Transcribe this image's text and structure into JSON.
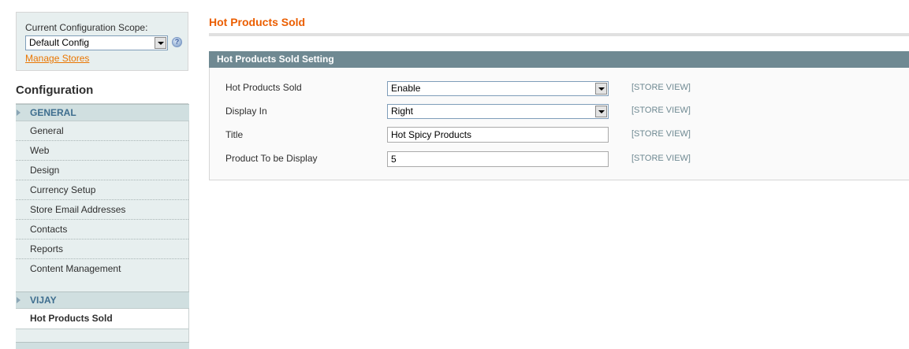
{
  "scope": {
    "label": "Current Configuration Scope:",
    "selected": "Default Config",
    "manage_link": "Manage Stores",
    "help_glyph": "?"
  },
  "sidebar": {
    "title": "Configuration",
    "groups": [
      {
        "label": "GENERAL",
        "items": [
          {
            "label": "General"
          },
          {
            "label": "Web"
          },
          {
            "label": "Design"
          },
          {
            "label": "Currency Setup"
          },
          {
            "label": "Store Email Addresses"
          },
          {
            "label": "Contacts"
          },
          {
            "label": "Reports"
          },
          {
            "label": "Content Management"
          }
        ]
      },
      {
        "label": "VIJAY",
        "items": [
          {
            "label": "Hot Products Sold",
            "active": true
          }
        ]
      }
    ]
  },
  "main": {
    "title": "Hot Products Sold",
    "fieldset": {
      "title": "Hot Products Sold Setting",
      "rows": [
        {
          "label": "Hot Products Sold",
          "type": "select",
          "value": "Enable",
          "scope": "[STORE VIEW]"
        },
        {
          "label": "Display In",
          "type": "select",
          "value": "Right",
          "scope": "[STORE VIEW]"
        },
        {
          "label": "Title",
          "type": "text",
          "value": "Hot Spicy Products",
          "scope": "[STORE VIEW]"
        },
        {
          "label": "Product To be Display",
          "type": "text",
          "value": "5",
          "scope": "[STORE VIEW]"
        }
      ]
    }
  },
  "colors": {
    "accent_orange": "#eb5e00",
    "link_orange": "#ea7601",
    "fieldset_header": "#6f8992",
    "sidebar_bg": "#e7efef",
    "group_header_bg": "#d0dfe0",
    "group_header_text": "#3d6d8e"
  }
}
